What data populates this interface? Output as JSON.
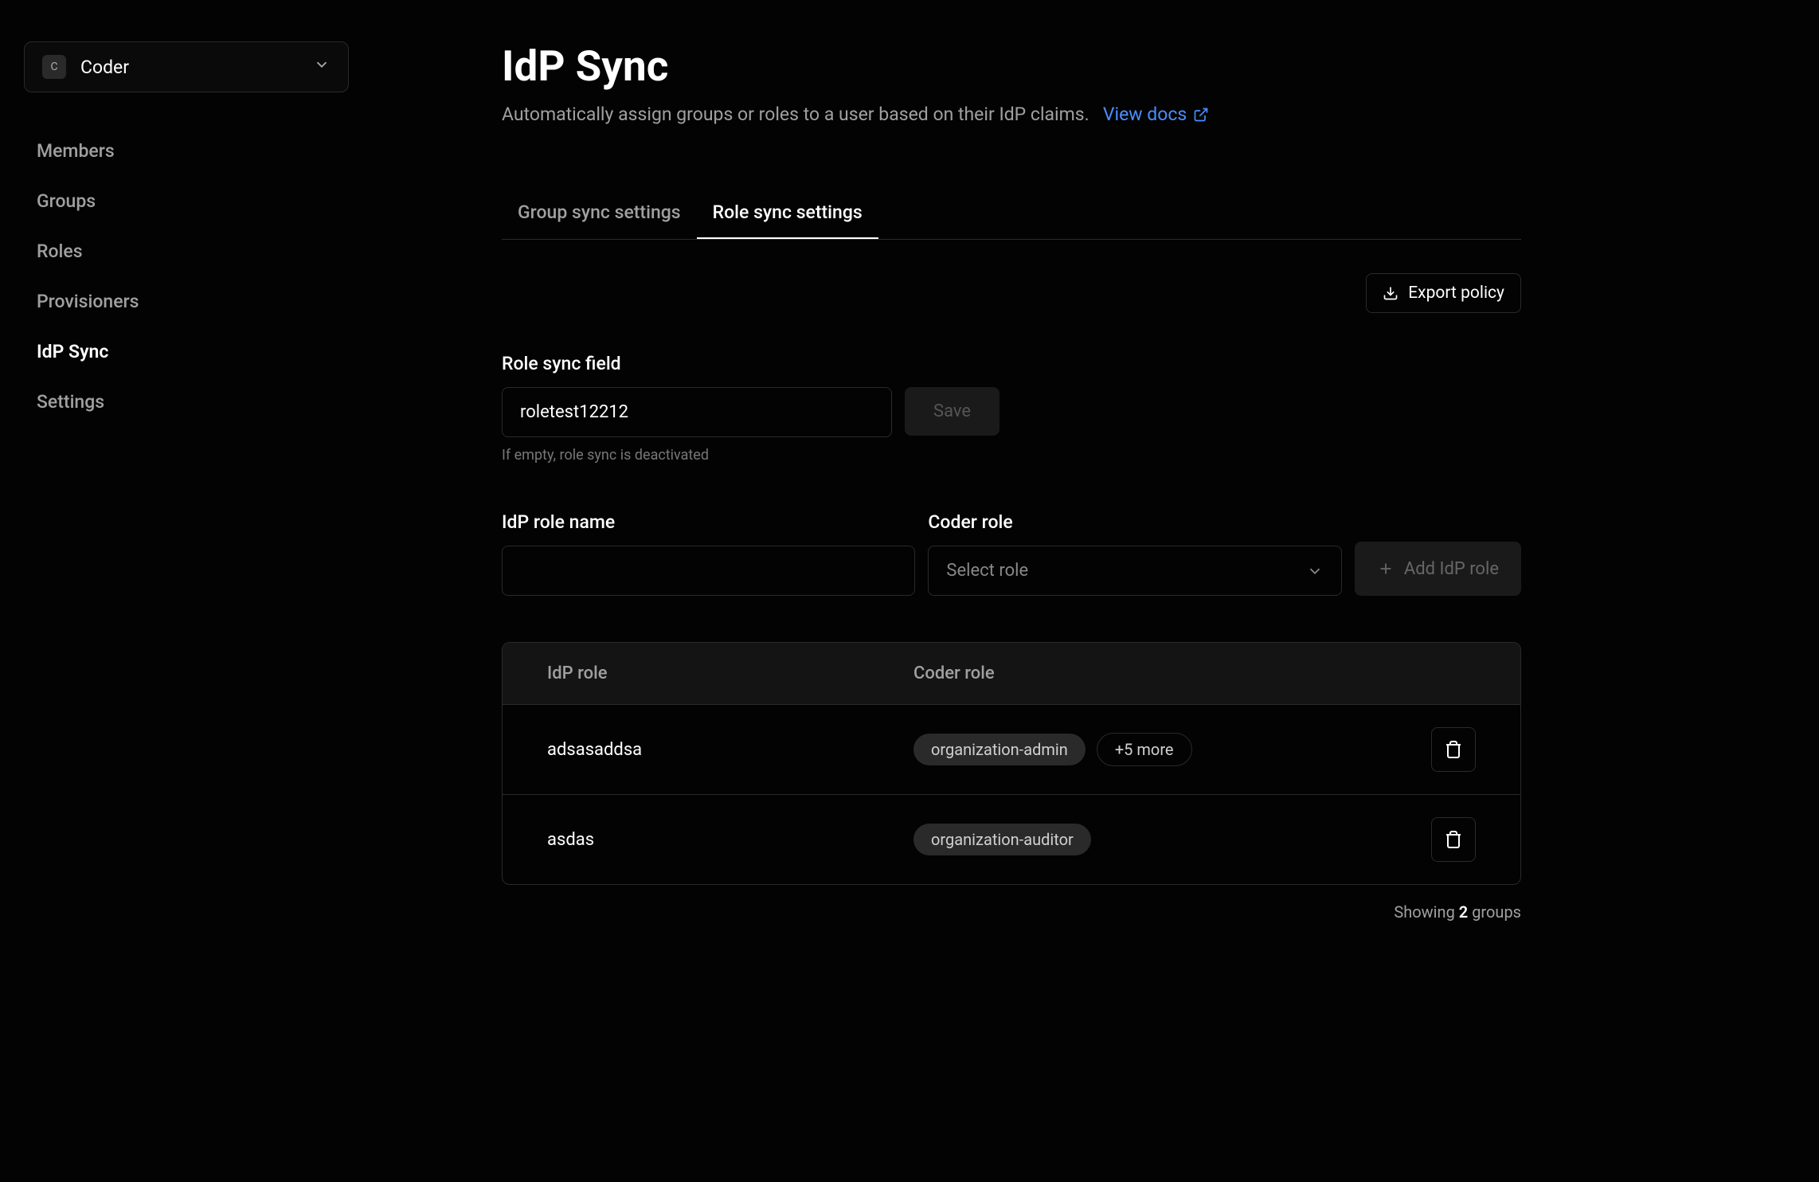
{
  "org_selector": {
    "badge": "C",
    "name": "Coder"
  },
  "sidebar": {
    "items": [
      {
        "label": "Members",
        "active": false
      },
      {
        "label": "Groups",
        "active": false
      },
      {
        "label": "Roles",
        "active": false
      },
      {
        "label": "Provisioners",
        "active": false
      },
      {
        "label": "IdP Sync",
        "active": true
      },
      {
        "label": "Settings",
        "active": false
      }
    ]
  },
  "header": {
    "title": "IdP Sync",
    "subtitle": "Automatically assign groups or roles to a user based on their IdP claims.",
    "docs_link_label": "View docs"
  },
  "tabs": [
    {
      "label": "Group sync settings",
      "active": false
    },
    {
      "label": "Role sync settings",
      "active": true
    }
  ],
  "export_button_label": "Export policy",
  "role_sync_field": {
    "label": "Role sync field",
    "value": "roletest12212",
    "help": "If empty, role sync is deactivated",
    "save_label": "Save"
  },
  "mapping_form": {
    "idp_label": "IdP role name",
    "idp_value": "",
    "coder_label": "Coder role",
    "coder_placeholder": "Select role",
    "add_button_label": "Add IdP role"
  },
  "table": {
    "headers": {
      "idp": "IdP role",
      "coder": "Coder role"
    },
    "rows": [
      {
        "idp": "adsasaddsa",
        "roles": [
          "organization-admin"
        ],
        "more_count": 5
      },
      {
        "idp": "asdas",
        "roles": [
          "organization-auditor"
        ],
        "more_count": 0
      }
    ],
    "footer": {
      "prefix": "Showing ",
      "count": "2",
      "suffix": " groups"
    }
  }
}
